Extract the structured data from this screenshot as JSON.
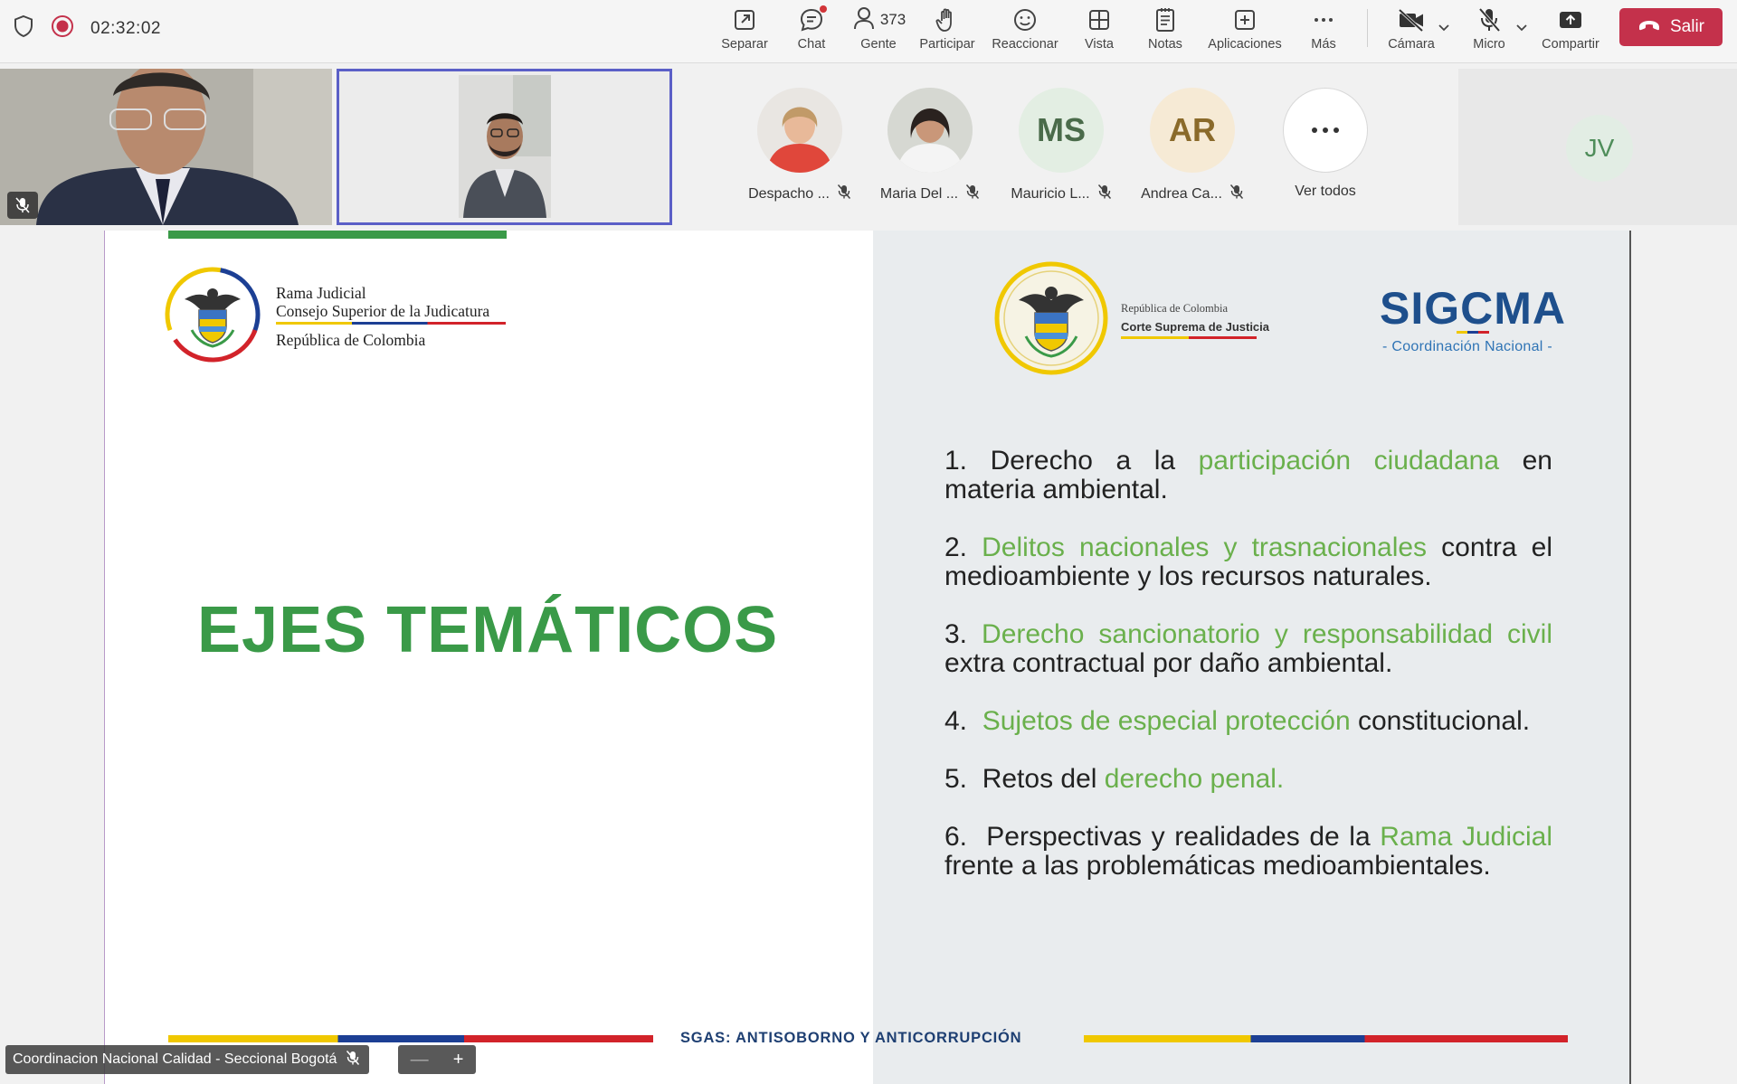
{
  "call": {
    "timer": "02:32:02"
  },
  "toolbar": {
    "buttons": [
      {
        "label": "Separar",
        "icon": "pop-out-icon"
      },
      {
        "label": "Chat",
        "icon": "chat-icon"
      },
      {
        "label": "Gente",
        "icon": "people-icon",
        "count": "373"
      },
      {
        "label": "Participar",
        "icon": "raise-hand-icon"
      },
      {
        "label": "Reaccionar",
        "icon": "smiley-icon"
      },
      {
        "label": "Vista",
        "icon": "grid-view-icon"
      },
      {
        "label": "Notas",
        "icon": "notes-icon"
      },
      {
        "label": "Aplicaciones",
        "icon": "apps-plus-icon"
      },
      {
        "label": "Más",
        "icon": "more-icon"
      },
      {
        "label": "Cámara",
        "icon": "camera-off-icon"
      },
      {
        "label": "Micro",
        "icon": "mic-off-icon"
      },
      {
        "label": "Compartir",
        "icon": "share-icon"
      }
    ],
    "leave_label": "Salir",
    "accent": "#c4314b"
  },
  "participants": [
    {
      "name": "Despacho ...",
      "type": "photo",
      "bg": "#d9534f"
    },
    {
      "name": "Maria Del ...",
      "type": "photo",
      "bg": "#e6e6e6"
    },
    {
      "name": "Mauricio L...",
      "initials": "MS",
      "bg": "#e3eee3",
      "fg": "#4a6b4a"
    },
    {
      "name": "Andrea Ca...",
      "initials": "AR",
      "bg": "#f6ead5",
      "fg": "#8a6a2a"
    }
  ],
  "view_all": {
    "label": "Ver todos"
  },
  "overflow_participant": {
    "initials": "JV"
  },
  "slide": {
    "left_org_line1": "Rama Judicial",
    "left_org_line2": "Consejo Superior de la Judicatura",
    "left_org_line3": "República de Colombia",
    "title": "EJES TEMÁTICOS",
    "right_org_line1": "República de Colombia",
    "right_org_line2": "Corte Suprema de Justicia",
    "sig_title": "SIGCMA",
    "sig_subtitle": "- Coordinación Nacional -",
    "topics": [
      {
        "num": "1.",
        "parts": [
          {
            "t": " Derecho a la ",
            "hl": false
          },
          {
            "t": "participación ciudadana",
            "hl": true
          },
          {
            "t": " en materia ambiental.",
            "hl": false
          }
        ]
      },
      {
        "num": "2.",
        "parts": [
          {
            "t": " ",
            "hl": false
          },
          {
            "t": "Delitos nacionales y trasnacionales",
            "hl": true
          },
          {
            "t": " contra el medioambiente y los recursos naturales.",
            "hl": false
          }
        ]
      },
      {
        "num": "3.",
        "parts": [
          {
            "t": " ",
            "hl": false
          },
          {
            "t": "Derecho sancionatorio y responsabilidad civil",
            "hl": true
          },
          {
            "t": " extra contractual por daño ambiental.",
            "hl": false
          }
        ]
      },
      {
        "num": "4.",
        "parts": [
          {
            "t": "  ",
            "hl": false
          },
          {
            "t": "Sujetos de especial protección",
            "hl": true
          },
          {
            "t": " constitucional.",
            "hl": false
          }
        ]
      },
      {
        "num": "5.",
        "parts": [
          {
            "t": "  Retos del ",
            "hl": false
          },
          {
            "t": "derecho penal.",
            "hl": true
          }
        ]
      },
      {
        "num": "6.",
        "parts": [
          {
            "t": "  Perspectivas y realidades de la ",
            "hl": false
          },
          {
            "t": "Rama Judicial",
            "hl": true
          },
          {
            "t": " frente a las problemáticas medioambientales.",
            "hl": false
          }
        ]
      }
    ],
    "footer": "SGAS: ANTISOBORNO Y ANTICORRUPCIÓN",
    "accent_green": "#3a9a48",
    "highlight_green": "#6ab04c"
  },
  "presenter": {
    "name": "Coordinacion Nacional Calidad - Seccional Bogotá",
    "zoom_out": "—",
    "zoom_in": "+"
  }
}
